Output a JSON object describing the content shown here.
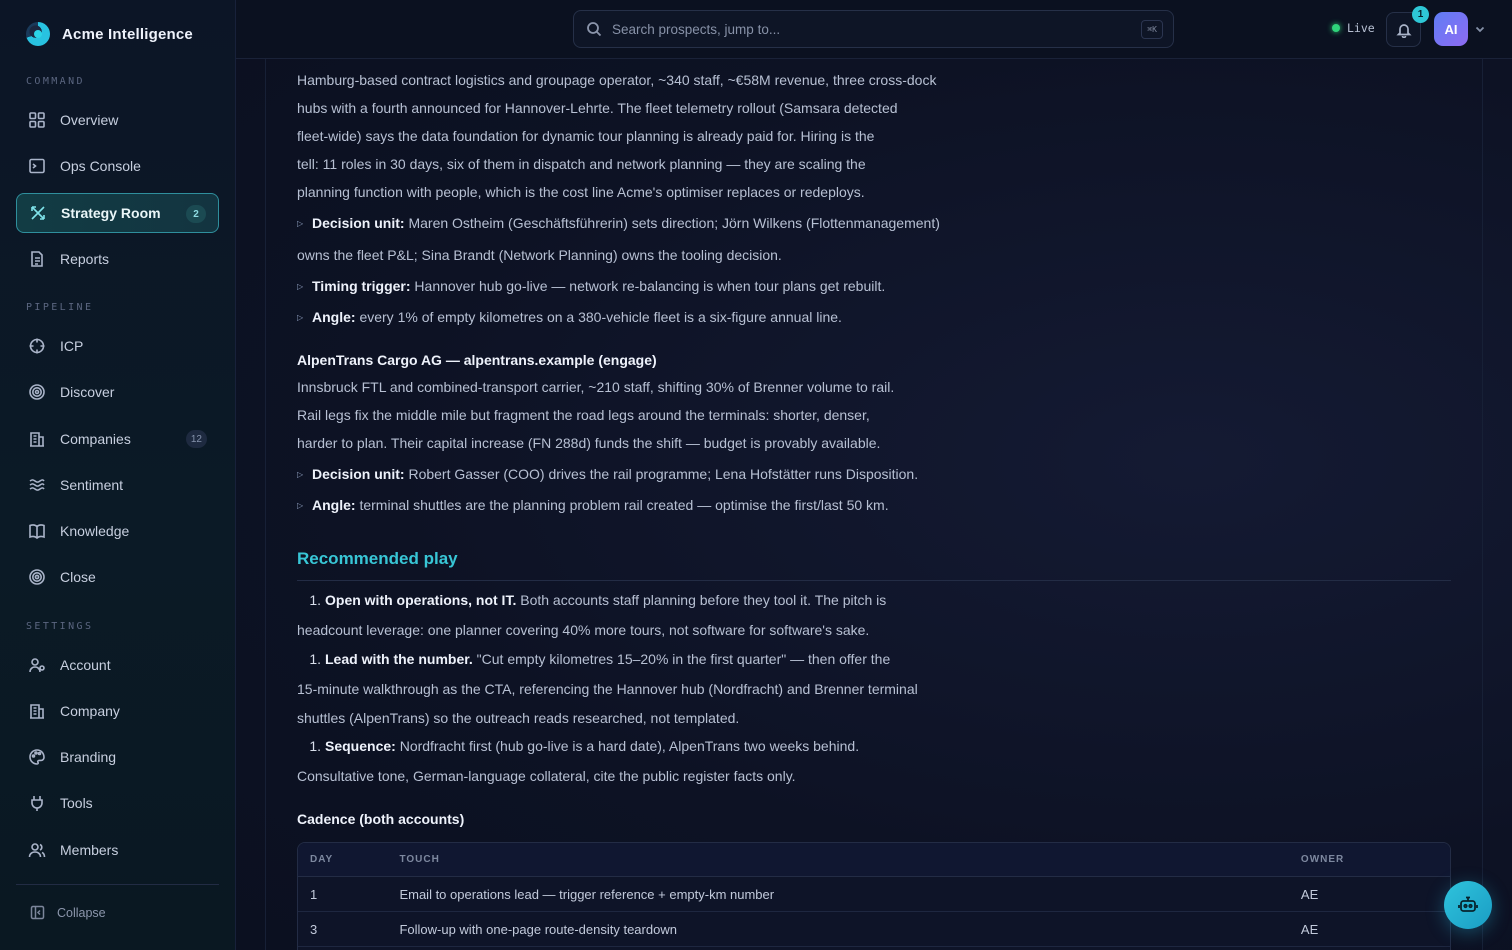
{
  "app": {
    "name": "Acme Intelligence"
  },
  "sidebar": {
    "sections": [
      {
        "label": "COMMAND"
      },
      {
        "label": "PIPELINE"
      },
      {
        "label": "SETTINGS"
      }
    ],
    "items": [
      {
        "label": "Overview",
        "icon": "grid-icon"
      },
      {
        "label": "Ops Console",
        "icon": "terminal-icon"
      },
      {
        "label": "Strategy Room",
        "icon": "strategy-icon",
        "badge": "2",
        "active": true
      },
      {
        "label": "Reports",
        "icon": "document-icon"
      },
      {
        "label": "ICP",
        "icon": "target-icon"
      },
      {
        "label": "Discover",
        "icon": "radar-icon"
      },
      {
        "label": "Companies",
        "icon": "building-icon",
        "badge": "12"
      },
      {
        "label": "Sentiment",
        "icon": "waves-icon"
      },
      {
        "label": "Knowledge",
        "icon": "book-icon"
      },
      {
        "label": "Close",
        "icon": "bullseye-icon"
      },
      {
        "label": "Account",
        "icon": "user-icon"
      },
      {
        "label": "Company",
        "icon": "building-icon"
      },
      {
        "label": "Branding",
        "icon": "palette-icon"
      },
      {
        "label": "Tools",
        "icon": "plug-icon"
      },
      {
        "label": "Members",
        "icon": "users-icon"
      }
    ],
    "collapse_label": "Collapse"
  },
  "topbar": {
    "search_placeholder": "Search prospects, jump to...",
    "search_shortcut": "⌘K",
    "live_label": "Live",
    "notification_count": "1",
    "avatar_initials": "AI"
  },
  "content": {
    "nordfracht": {
      "summary": [
        "Hamburg-based contract logistics and groupage operator, ~340 staff, ~€58M revenue, three cross-dock",
        "hubs with a fourth announced for Hannover-Lehrte. The fleet telemetry rollout (Samsara detected",
        "fleet-wide) says the data foundation for dynamic tour planning is already paid for. Hiring is the",
        "tell: 11 roles in 30 days, six of them in dispatch and network planning — they are scaling the",
        "planning function with people, which is the cost line Acme's optimiser replaces or redeploys."
      ],
      "decision_unit_label": "Decision unit:",
      "decision_unit_text": " Maren Ostheim (Geschäftsführerin) sets direction; Jörn Wilkens (Flottenmanagement)",
      "decision_unit_cont": "owns the fleet P&L; Sina Brandt (Network Planning) owns the tooling decision.",
      "timing_label": "Timing trigger:",
      "timing_text": " Hannover hub go-live — network re-balancing is when tour plans get rebuilt.",
      "angle_label": "Angle:",
      "angle_text": " every 1% of empty kilometres on a 380-vehicle fleet is a six-figure annual line."
    },
    "alpentrans": {
      "title": "AlpenTrans Cargo AG — alpentrans.example (engage)",
      "summary": [
        "Innsbruck FTL and combined-transport carrier, ~210 staff, shifting 30% of Brenner volume to rail.",
        "Rail legs fix the middle mile but fragment the road legs around the terminals: shorter, denser,",
        "harder to plan. Their capital increase (FN 288d) funds the shift — budget is provably available."
      ],
      "decision_unit_label": "Decision unit:",
      "decision_unit_text": " Robert Gasser (COO) drives the rail programme; Lena Hofstätter runs Disposition.",
      "angle_label": "Angle:",
      "angle_text": " terminal shuttles are the planning problem rail created — optimise the first/last 50 km."
    },
    "recommended": {
      "heading": "Recommended play",
      "steps": [
        {
          "n": "1.",
          "bold": "Open with operations, not IT.",
          "text": " Both accounts staff planning before they tool it. The pitch is",
          "cont": [
            "headcount leverage: one planner covering 40% more tours, not software for software's sake."
          ]
        },
        {
          "n": "1.",
          "bold": "Lead with the number.",
          "text": " \"Cut empty kilometres 15–20% in the first quarter\" — then offer the",
          "cont": [
            "15-minute walkthrough as the CTA, referencing the Hannover hub (Nordfracht) and Brenner terminal",
            "shuttles (AlpenTrans) so the outreach reads researched, not templated."
          ]
        },
        {
          "n": "1.",
          "bold": "Sequence:",
          "text": " Nordfracht first (hub go-live is a hard date), AlpenTrans two weeks behind.",
          "cont": [
            "Consultative tone, German-language collateral, cite the public register facts only."
          ]
        }
      ]
    },
    "cadence": {
      "heading": "Cadence (both accounts)",
      "columns": [
        "DAY",
        "TOUCH",
        "OWNER"
      ],
      "rows": [
        {
          "day": "1",
          "touch": "Email to operations lead — trigger reference + empty-km number",
          "owner": "AE"
        },
        {
          "day": "3",
          "touch": "Follow-up with one-page route-density teardown",
          "owner": "AE"
        }
      ]
    }
  },
  "colors": {
    "accent": "#38c6d6",
    "live": "#2fd47a",
    "avatar": "#6f74f3"
  }
}
